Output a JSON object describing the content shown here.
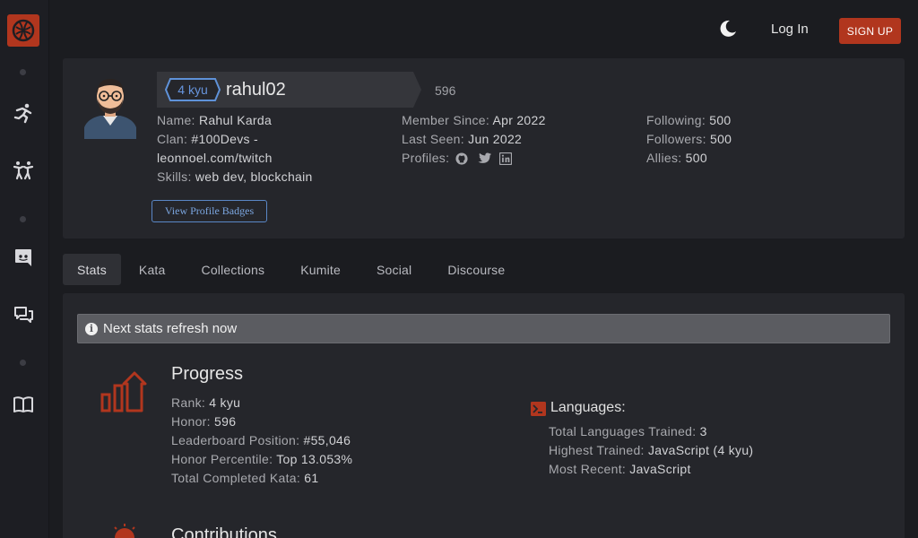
{
  "topbar": {
    "login_label": "Log In",
    "signup_label": "SIGN UP",
    "theme_icon": "moon-icon"
  },
  "sidebar": {
    "items": [
      "training-icon",
      "kumite-icon",
      "discord-icon",
      "forum-icon",
      "docs-icon"
    ]
  },
  "profile": {
    "rank_badge": "4 kyu",
    "username": "rahul02",
    "honor": "596",
    "col1": {
      "name_label": "Name:",
      "name": "Rahul Karda",
      "clan_label": "Clan:",
      "clan": "#100Devs -",
      "clan_cont": "leonnoel.com/twitch",
      "skills_label": "Skills:",
      "skills": "web dev, blockchain"
    },
    "col2": {
      "member_label": "Member Since:",
      "member": "Apr 2022",
      "seen_label": "Last Seen:",
      "seen": "Jun 2022",
      "profiles_label": "Profiles:"
    },
    "col3": {
      "following_label": "Following:",
      "following": "500",
      "followers_label": "Followers:",
      "followers": "500",
      "allies_label": "Allies:",
      "allies": "500"
    },
    "badges_button": "View Profile Badges"
  },
  "tabs": [
    "Stats",
    "Kata",
    "Collections",
    "Kumite",
    "Social",
    "Discourse"
  ],
  "notice": "Next stats refresh now",
  "progress": {
    "title": "Progress",
    "rank_label": "Rank:",
    "rank": "4 kyu",
    "honor_label": "Honor:",
    "honor": "596",
    "leader_label": "Leaderboard Position:",
    "leader": "#55,046",
    "percentile_label": "Honor Percentile:",
    "percentile": "Top 13.053%",
    "completed_label": "Total Completed Kata:",
    "completed": "61"
  },
  "languages": {
    "title": "Languages:",
    "total_label": "Total Languages Trained:",
    "total": "3",
    "highest_label": "Highest Trained:",
    "highest": "JavaScript (4 kyu)",
    "recent_label": "Most Recent:",
    "recent": "JavaScript"
  },
  "contributions": {
    "title": "Contributions"
  },
  "colors": {
    "accent": "#b1361e",
    "link": "#5a87c6",
    "bg": "#1b1c20",
    "panel": "#25262b"
  }
}
